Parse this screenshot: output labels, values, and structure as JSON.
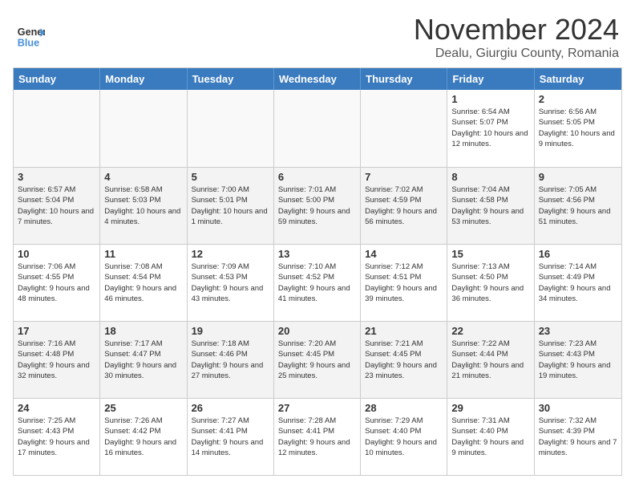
{
  "header": {
    "logo_line1": "General",
    "logo_line2": "Blue",
    "month_title": "November 2024",
    "location": "Dealu, Giurgiu County, Romania"
  },
  "calendar": {
    "headers": [
      "Sunday",
      "Monday",
      "Tuesday",
      "Wednesday",
      "Thursday",
      "Friday",
      "Saturday"
    ],
    "weeks": [
      [
        {
          "day": "",
          "info": "",
          "empty": true
        },
        {
          "day": "",
          "info": "",
          "empty": true
        },
        {
          "day": "",
          "info": "",
          "empty": true
        },
        {
          "day": "",
          "info": "",
          "empty": true
        },
        {
          "day": "",
          "info": "",
          "empty": true
        },
        {
          "day": "1",
          "info": "Sunrise: 6:54 AM\nSunset: 5:07 PM\nDaylight: 10 hours and 12 minutes."
        },
        {
          "day": "2",
          "info": "Sunrise: 6:56 AM\nSunset: 5:05 PM\nDaylight: 10 hours and 9 minutes."
        }
      ],
      [
        {
          "day": "3",
          "info": "Sunrise: 6:57 AM\nSunset: 5:04 PM\nDaylight: 10 hours and 7 minutes."
        },
        {
          "day": "4",
          "info": "Sunrise: 6:58 AM\nSunset: 5:03 PM\nDaylight: 10 hours and 4 minutes."
        },
        {
          "day": "5",
          "info": "Sunrise: 7:00 AM\nSunset: 5:01 PM\nDaylight: 10 hours and 1 minute."
        },
        {
          "day": "6",
          "info": "Sunrise: 7:01 AM\nSunset: 5:00 PM\nDaylight: 9 hours and 59 minutes."
        },
        {
          "day": "7",
          "info": "Sunrise: 7:02 AM\nSunset: 4:59 PM\nDaylight: 9 hours and 56 minutes."
        },
        {
          "day": "8",
          "info": "Sunrise: 7:04 AM\nSunset: 4:58 PM\nDaylight: 9 hours and 53 minutes."
        },
        {
          "day": "9",
          "info": "Sunrise: 7:05 AM\nSunset: 4:56 PM\nDaylight: 9 hours and 51 minutes."
        }
      ],
      [
        {
          "day": "10",
          "info": "Sunrise: 7:06 AM\nSunset: 4:55 PM\nDaylight: 9 hours and 48 minutes."
        },
        {
          "day": "11",
          "info": "Sunrise: 7:08 AM\nSunset: 4:54 PM\nDaylight: 9 hours and 46 minutes."
        },
        {
          "day": "12",
          "info": "Sunrise: 7:09 AM\nSunset: 4:53 PM\nDaylight: 9 hours and 43 minutes."
        },
        {
          "day": "13",
          "info": "Sunrise: 7:10 AM\nSunset: 4:52 PM\nDaylight: 9 hours and 41 minutes."
        },
        {
          "day": "14",
          "info": "Sunrise: 7:12 AM\nSunset: 4:51 PM\nDaylight: 9 hours and 39 minutes."
        },
        {
          "day": "15",
          "info": "Sunrise: 7:13 AM\nSunset: 4:50 PM\nDaylight: 9 hours and 36 minutes."
        },
        {
          "day": "16",
          "info": "Sunrise: 7:14 AM\nSunset: 4:49 PM\nDaylight: 9 hours and 34 minutes."
        }
      ],
      [
        {
          "day": "17",
          "info": "Sunrise: 7:16 AM\nSunset: 4:48 PM\nDaylight: 9 hours and 32 minutes."
        },
        {
          "day": "18",
          "info": "Sunrise: 7:17 AM\nSunset: 4:47 PM\nDaylight: 9 hours and 30 minutes."
        },
        {
          "day": "19",
          "info": "Sunrise: 7:18 AM\nSunset: 4:46 PM\nDaylight: 9 hours and 27 minutes."
        },
        {
          "day": "20",
          "info": "Sunrise: 7:20 AM\nSunset: 4:45 PM\nDaylight: 9 hours and 25 minutes."
        },
        {
          "day": "21",
          "info": "Sunrise: 7:21 AM\nSunset: 4:45 PM\nDaylight: 9 hours and 23 minutes."
        },
        {
          "day": "22",
          "info": "Sunrise: 7:22 AM\nSunset: 4:44 PM\nDaylight: 9 hours and 21 minutes."
        },
        {
          "day": "23",
          "info": "Sunrise: 7:23 AM\nSunset: 4:43 PM\nDaylight: 9 hours and 19 minutes."
        }
      ],
      [
        {
          "day": "24",
          "info": "Sunrise: 7:25 AM\nSunset: 4:43 PM\nDaylight: 9 hours and 17 minutes."
        },
        {
          "day": "25",
          "info": "Sunrise: 7:26 AM\nSunset: 4:42 PM\nDaylight: 9 hours and 16 minutes."
        },
        {
          "day": "26",
          "info": "Sunrise: 7:27 AM\nSunset: 4:41 PM\nDaylight: 9 hours and 14 minutes."
        },
        {
          "day": "27",
          "info": "Sunrise: 7:28 AM\nSunset: 4:41 PM\nDaylight: 9 hours and 12 minutes."
        },
        {
          "day": "28",
          "info": "Sunrise: 7:29 AM\nSunset: 4:40 PM\nDaylight: 9 hours and 10 minutes."
        },
        {
          "day": "29",
          "info": "Sunrise: 7:31 AM\nSunset: 4:40 PM\nDaylight: 9 hours and 9 minutes."
        },
        {
          "day": "30",
          "info": "Sunrise: 7:32 AM\nSunset: 4:39 PM\nDaylight: 9 hours and 7 minutes."
        }
      ]
    ]
  }
}
